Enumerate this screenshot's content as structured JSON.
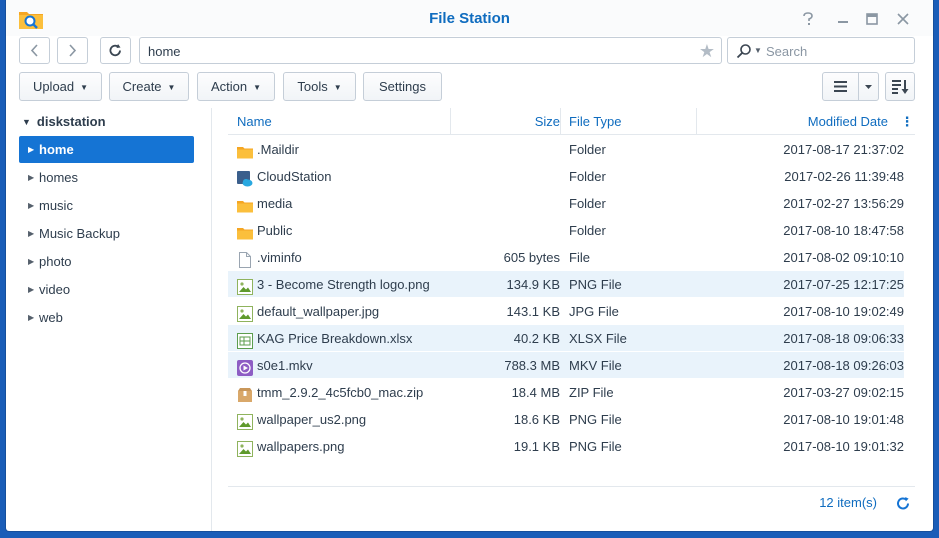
{
  "window": {
    "title": "File Station",
    "controls": [
      "?",
      "—",
      "□",
      "✕"
    ]
  },
  "toolbar": {
    "path": "home",
    "search_placeholder": "Search",
    "upload_label": "Upload",
    "create_label": "Create",
    "action_label": "Action",
    "tools_label": "Tools",
    "settings_label": "Settings"
  },
  "sidebar": {
    "root": "diskstation",
    "items": [
      {
        "label": "home",
        "active": true
      },
      {
        "label": "homes",
        "active": false
      },
      {
        "label": "music",
        "active": false
      },
      {
        "label": "Music Backup",
        "active": false
      },
      {
        "label": "photo",
        "active": false
      },
      {
        "label": "video",
        "active": false
      },
      {
        "label": "web",
        "active": false
      }
    ]
  },
  "columns": {
    "name": "Name",
    "size": "Size",
    "type": "File Type",
    "modified": "Modified Date"
  },
  "files": [
    {
      "name": ".Maildir",
      "size": "",
      "type": "Folder",
      "modified": "2017-08-17 21:37:02",
      "icon": "folder-icon",
      "selected": false
    },
    {
      "name": "CloudStation",
      "size": "",
      "type": "Folder",
      "modified": "2017-02-26 11:39:48",
      "icon": "cloud-station-icon",
      "selected": false
    },
    {
      "name": "media",
      "size": "",
      "type": "Folder",
      "modified": "2017-02-27 13:56:29",
      "icon": "folder-icon",
      "selected": false
    },
    {
      "name": "Public",
      "size": "",
      "type": "Folder",
      "modified": "2017-08-10 18:47:58",
      "icon": "folder-icon",
      "selected": false
    },
    {
      "name": ".viminfo",
      "size": "605 bytes",
      "type": "File",
      "modified": "2017-08-02 09:10:10",
      "icon": "file-icon",
      "selected": false
    },
    {
      "name": "3 - Become Strength logo.png",
      "size": "134.9 KB",
      "type": "PNG File",
      "modified": "2017-07-25 12:17:25",
      "icon": "image-icon",
      "selected": true
    },
    {
      "name": "default_wallpaper.jpg",
      "size": "143.1 KB",
      "type": "JPG File",
      "modified": "2017-08-10 19:02:49",
      "icon": "image-icon",
      "selected": false
    },
    {
      "name": "KAG Price Breakdown.xlsx",
      "size": "40.2 KB",
      "type": "XLSX File",
      "modified": "2017-08-18 09:06:33",
      "icon": "spreadsheet-icon",
      "selected": true
    },
    {
      "name": "s0e1.mkv",
      "size": "788.3 MB",
      "type": "MKV File",
      "modified": "2017-08-18 09:26:03",
      "icon": "video-icon",
      "selected": true
    },
    {
      "name": "tmm_2.9.2_4c5fcb0_mac.zip",
      "size": "18.4 MB",
      "type": "ZIP File",
      "modified": "2017-03-27 09:02:15",
      "icon": "archive-icon",
      "selected": false
    },
    {
      "name": "wallpaper_us2.png",
      "size": "18.6 KB",
      "type": "PNG File",
      "modified": "2017-08-10 19:01:48",
      "icon": "image-icon",
      "selected": false
    },
    {
      "name": "wallpapers.png",
      "size": "19.1 KB",
      "type": "PNG File",
      "modified": "2017-08-10 19:01:32",
      "icon": "image-icon",
      "selected": false
    }
  ],
  "status": {
    "count": "12 item(s)"
  },
  "colors": {
    "accent": "#1574d4",
    "title": "#0f6cbf",
    "selected_row": "#e9f3fb",
    "folder": "#f5a623",
    "desktop": "#1a5db8"
  }
}
